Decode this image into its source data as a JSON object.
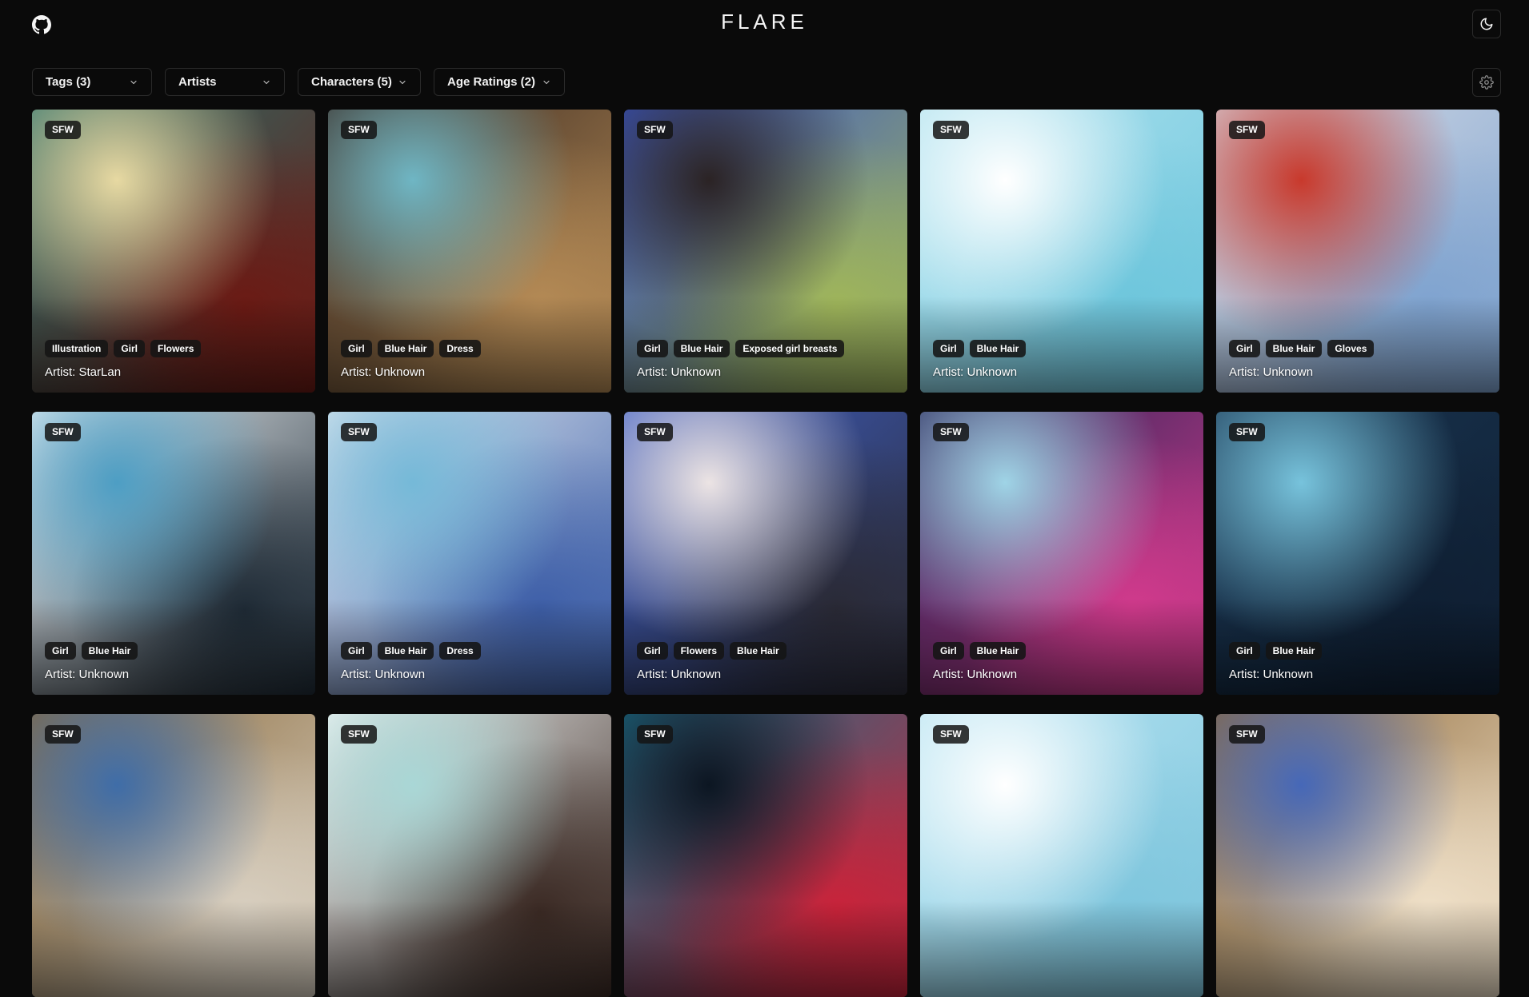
{
  "header": {
    "brand": "FLARE",
    "github_icon": "github-icon",
    "theme_icon": "moon-icon"
  },
  "filters": [
    {
      "label": "Tags (3)"
    },
    {
      "label": "Artists"
    },
    {
      "label": "Characters (5)"
    },
    {
      "label": "Age Ratings (2)"
    }
  ],
  "settings_icon": "gear-icon",
  "cards": [
    {
      "rating": "SFW",
      "tags": [
        "Illustration",
        "Girl",
        "Flowers"
      ],
      "artist": "Artist: StarLan",
      "colors": [
        "#2a6f6a",
        "#e7d9a2",
        "#6b1a14"
      ]
    },
    {
      "rating": "SFW",
      "tags": [
        "Girl",
        "Blue Hair",
        "Dress"
      ],
      "artist": "Artist: Unknown",
      "colors": [
        "#3a2a22",
        "#6fb6c4",
        "#b48a55"
      ]
    },
    {
      "rating": "SFW",
      "tags": [
        "Girl",
        "Blue Hair",
        "Exposed girl breasts"
      ],
      "artist": "Artist: Unknown",
      "colors": [
        "#3b58c7",
        "#2b2324",
        "#9fb55a"
      ]
    },
    {
      "rating": "SFW",
      "tags": [
        "Girl",
        "Blue Hair"
      ],
      "artist": "Artist: Unknown",
      "colors": [
        "#aee2ef",
        "#ffffff",
        "#6ec6dc"
      ]
    },
    {
      "rating": "SFW",
      "tags": [
        "Girl",
        "Blue Hair",
        "Gloves"
      ],
      "artist": "Artist: Unknown",
      "colors": [
        "#d7dce6",
        "#c8392c",
        "#7fa3cf"
      ]
    },
    {
      "rating": "SFW",
      "tags": [
        "Girl",
        "Blue Hair"
      ],
      "artist": "Artist: Unknown",
      "colors": [
        "#eef4f7",
        "#4d9ec4",
        "#1f2b36"
      ]
    },
    {
      "rating": "SFW",
      "tags": [
        "Girl",
        "Blue Hair",
        "Dress"
      ],
      "artist": "Artist: Unknown",
      "colors": [
        "#dfe8f0",
        "#75b9d8",
        "#3e5fa8"
      ]
    },
    {
      "rating": "SFW",
      "tags": [
        "Girl",
        "Flowers",
        "Blue Hair"
      ],
      "artist": "Artist: Unknown",
      "colors": [
        "#3f5fc4",
        "#ece4e4",
        "#2a2a36"
      ]
    },
    {
      "rating": "SFW",
      "tags": [
        "Girl",
        "Blue Hair"
      ],
      "artist": "Artist: Unknown",
      "colors": [
        "#2a2558",
        "#9fd4e6",
        "#d13a8c"
      ]
    },
    {
      "rating": "SFW",
      "tags": [
        "Girl",
        "Blue Hair"
      ],
      "artist": "Artist: Unknown",
      "colors": [
        "#1a3652",
        "#77c3dc",
        "#0f1f33"
      ]
    },
    {
      "rating": "SFW",
      "tags": [],
      "artist": "",
      "colors": [
        "#8a6a3c",
        "#3f6da8",
        "#d8cfc0"
      ]
    },
    {
      "rating": "SFW",
      "tags": [],
      "artist": "",
      "colors": [
        "#f1f4f3",
        "#a9d7d6",
        "#3b2a24"
      ]
    },
    {
      "rating": "SFW",
      "tags": [],
      "artist": "",
      "colors": [
        "#1d6d86",
        "#0c1622",
        "#c9233a"
      ]
    },
    {
      "rating": "SFW",
      "tags": [],
      "artist": "",
      "colors": [
        "#b7e4f2",
        "#ffffff",
        "#7fc6dd"
      ]
    },
    {
      "rating": "SFW",
      "tags": [],
      "artist": "",
      "colors": [
        "#8f6a3a",
        "#4668b8",
        "#efe0c8"
      ]
    }
  ]
}
